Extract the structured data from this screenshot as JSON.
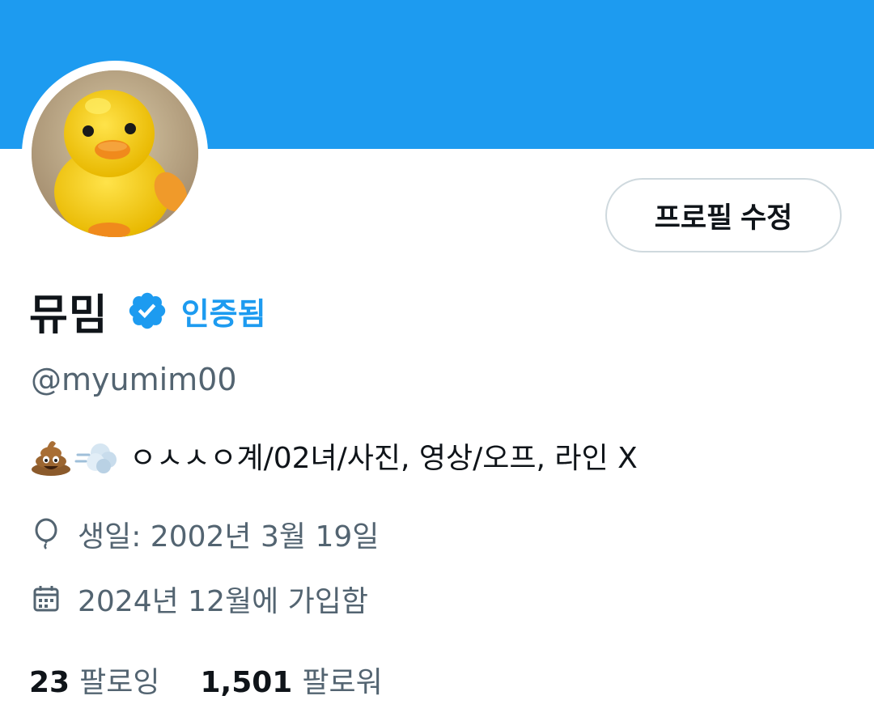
{
  "profile": {
    "display_name": "뮤밈",
    "verified_label": "인증됨",
    "handle": "@myumim00",
    "bio_text": "ㅇㅅㅅㅇ계/02녀/사진,  영상/오프, 라인 X",
    "bio_emojis": [
      "pile-of-poo-icon",
      "dash-cloud-icon"
    ],
    "birthday": "생일: 2002년 3월 19일",
    "joined": "2024년 12월에 가입함",
    "following_count": "23",
    "following_label": "팔로잉",
    "followers_count": "1,501",
    "followers_label": "팔로워"
  },
  "actions": {
    "edit_profile_label": "프로필 수정"
  },
  "colors": {
    "banner": "#1d9bf0",
    "accent": "#1d9bf0",
    "secondary_text": "#536471",
    "primary_text": "#0f1419"
  },
  "icons": {
    "verified": "verified-badge-icon",
    "birthday": "balloon-icon",
    "joined": "calendar-icon"
  }
}
